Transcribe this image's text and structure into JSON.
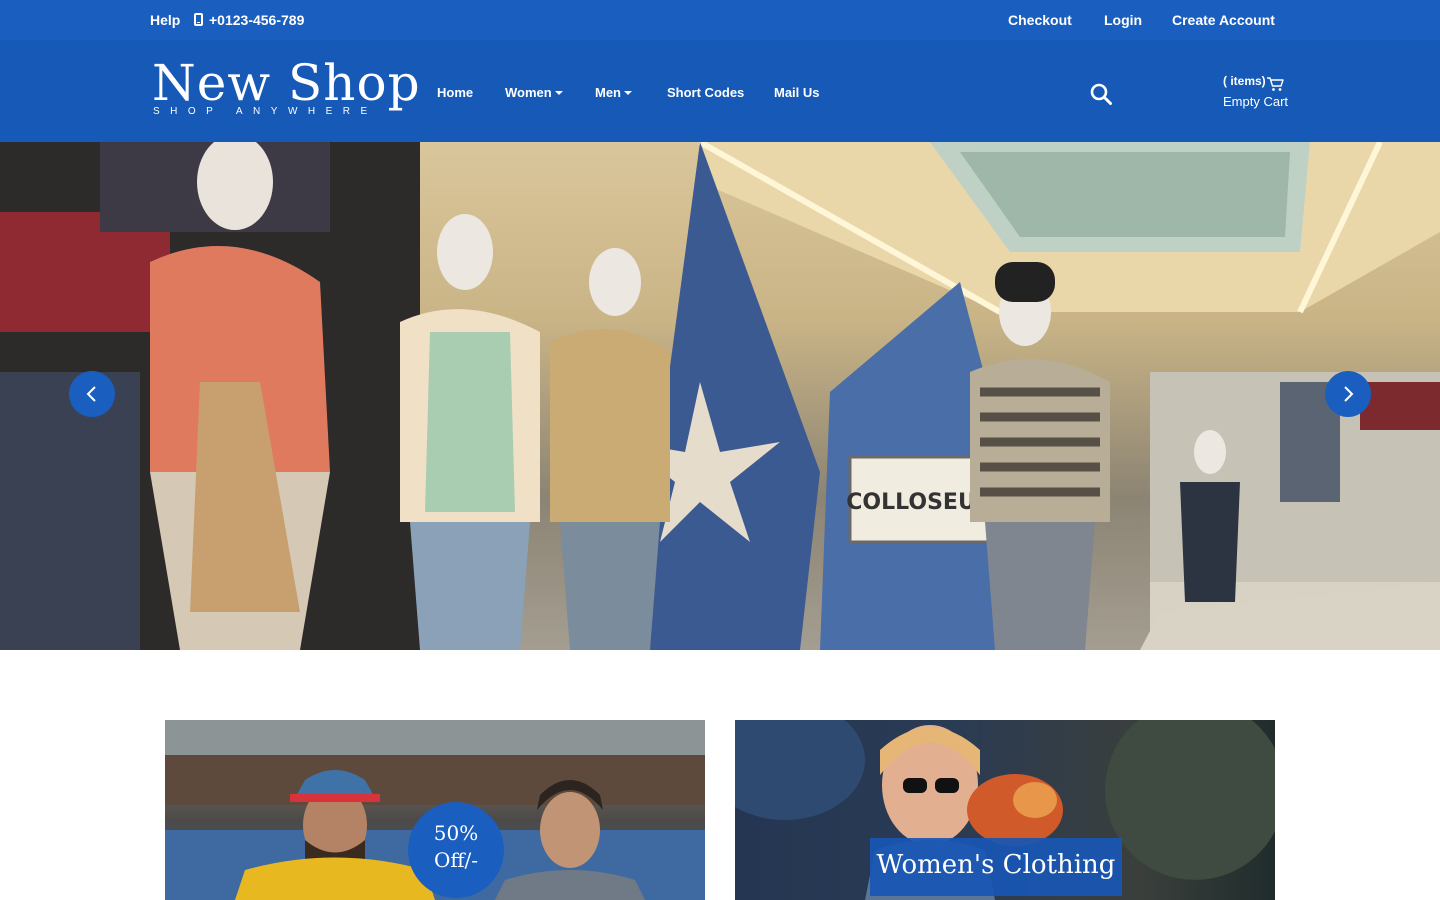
{
  "topbar": {
    "help": "Help",
    "phone": "+0123-456-789",
    "checkout": "Checkout",
    "login": "Login",
    "create_account": "Create Account"
  },
  "logo": {
    "title": "New Shop",
    "tagline": "SHOP ANYWHERE"
  },
  "nav": {
    "home": "Home",
    "women": "Women",
    "men": "Men",
    "short_codes": "Short Codes",
    "mail_us": "Mail Us"
  },
  "cart": {
    "items_label": "( items)",
    "empty_label": "Empty Cart"
  },
  "hero": {
    "sign_text": "COLLOSEUM"
  },
  "banners": {
    "discount_line1": "50%",
    "discount_line2": "Off/-",
    "womens_clothing": "Women's Clothing"
  },
  "icons": {
    "phone": "phone-icon",
    "search": "search-icon",
    "cart": "cart-icon",
    "prev": "chevron-left-icon",
    "next": "chevron-right-icon"
  },
  "colors": {
    "topbar_bg": "#1a5fbf",
    "header_bg": "#1659b6",
    "accent": "#1a5fbf",
    "text": "#ffffff"
  }
}
